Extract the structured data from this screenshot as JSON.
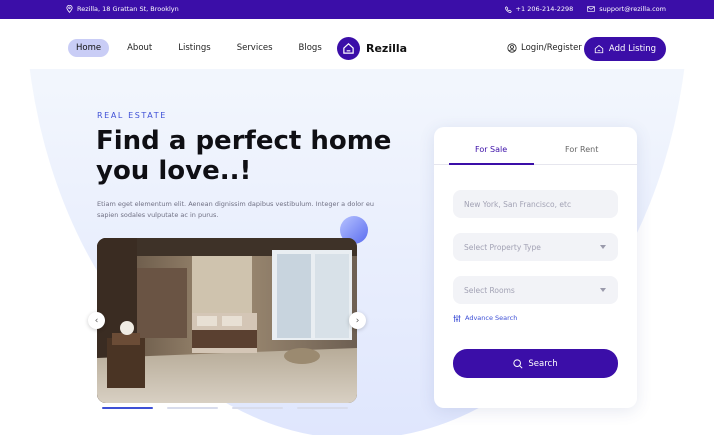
{
  "topbar": {
    "address": "Rezilla, 18 Grattan St, Brooklyn",
    "phone": "+1 206-214-2298",
    "email": "support@rezilla.com"
  },
  "nav": {
    "links": [
      "Home",
      "About",
      "Listings",
      "Services",
      "Blogs"
    ],
    "active": "Home",
    "brand": "Rezilla",
    "login": "Login/Register",
    "add_listing": "Add Listing"
  },
  "hero": {
    "eyebrow": "REAL ESTATE",
    "headline": "Find a perfect home you love..!",
    "subtext": "Etiam eget elementum elit. Aenean dignissim dapibus vestibulum. Integer a dolor eu sapien sodales vulputate ac in purus.",
    "slider": {
      "total_slides": 4,
      "active_slide": 1
    }
  },
  "search_card": {
    "tabs": [
      "For Sale",
      "For Rent"
    ],
    "active_tab": "For Sale",
    "location_placeholder": "New York, San Francisco, etc",
    "property_type_placeholder": "Select Property Type",
    "rooms_placeholder": "Select Rooms",
    "advance_search": "Advance Search",
    "search_button": "Search"
  },
  "colors": {
    "brand": "#3b0ea8",
    "accent": "#3e50d6",
    "nav_active_bg": "#c9cdf6"
  },
  "icons": [
    "location-pin-icon",
    "phone-icon",
    "mail-icon",
    "home-logo-icon",
    "user-circle-icon",
    "house-icon",
    "chevron-left-icon",
    "chevron-right-icon",
    "sliders-icon",
    "search-icon",
    "caret-down-icon"
  ]
}
